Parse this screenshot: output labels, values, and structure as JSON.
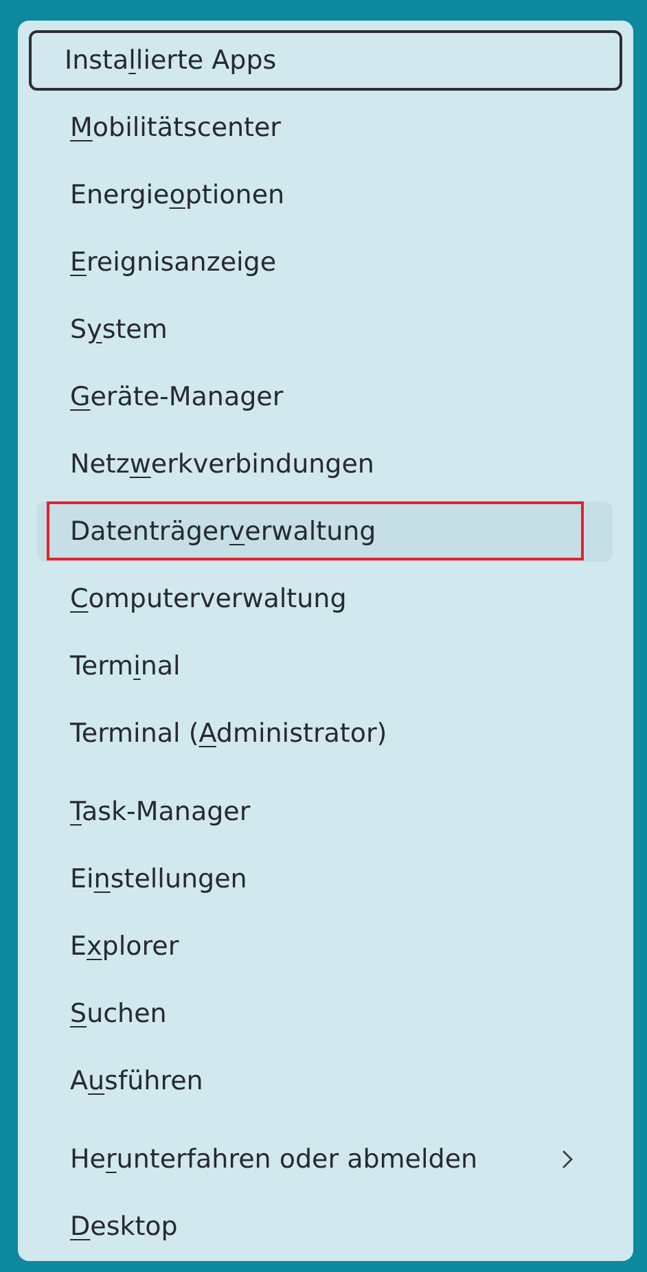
{
  "groups": [
    {
      "items": [
        {
          "before": "Insta",
          "key": "l",
          "after": "lierte Apps",
          "focused": true,
          "highlighted": false,
          "submenu": false
        },
        {
          "key": "M",
          "after": "obilitätscenter",
          "focused": false,
          "highlighted": false,
          "submenu": false
        },
        {
          "before": "Energie",
          "key": "o",
          "after": "ptionen",
          "focused": false,
          "highlighted": false,
          "submenu": false
        },
        {
          "key": "E",
          "after": "reignisanzeige",
          "focused": false,
          "highlighted": false,
          "submenu": false
        },
        {
          "before": "S",
          "key": "y",
          "after": "stem",
          "focused": false,
          "highlighted": false,
          "submenu": false
        },
        {
          "key": "G",
          "after": "eräte-Manager",
          "focused": false,
          "highlighted": false,
          "submenu": false
        },
        {
          "before": "Netz",
          "key": "w",
          "after": "erkverbindungen",
          "focused": false,
          "highlighted": false,
          "submenu": false
        },
        {
          "before": "Datenträger",
          "key": "v",
          "after": "erwaltung",
          "focused": false,
          "highlighted": true,
          "submenu": false
        },
        {
          "key": "C",
          "after": "omputerverwaltung",
          "focused": false,
          "highlighted": false,
          "submenu": false
        },
        {
          "before": "Term",
          "key": "i",
          "after": "nal",
          "focused": false,
          "highlighted": false,
          "submenu": false
        },
        {
          "before": "Terminal (",
          "key": "A",
          "after": "dministrator)",
          "focused": false,
          "highlighted": false,
          "submenu": false
        }
      ]
    },
    {
      "items": [
        {
          "key": "T",
          "after": "ask-Manager",
          "focused": false,
          "highlighted": false,
          "submenu": false
        },
        {
          "before": "Ei",
          "key": "n",
          "after": "stellungen",
          "focused": false,
          "highlighted": false,
          "submenu": false
        },
        {
          "before": "E",
          "key": "x",
          "after": "plorer",
          "focused": false,
          "highlighted": false,
          "submenu": false
        },
        {
          "key": "S",
          "after": "uchen",
          "focused": false,
          "highlighted": false,
          "submenu": false
        },
        {
          "before": "A",
          "key": "u",
          "after": "sführen",
          "focused": false,
          "highlighted": false,
          "submenu": false
        }
      ]
    },
    {
      "items": [
        {
          "before": "He",
          "key": "r",
          "after": "unterfahren oder abmelden",
          "focused": false,
          "highlighted": false,
          "submenu": true
        },
        {
          "key": "D",
          "after": "esktop",
          "focused": false,
          "highlighted": false,
          "submenu": false
        }
      ]
    }
  ]
}
